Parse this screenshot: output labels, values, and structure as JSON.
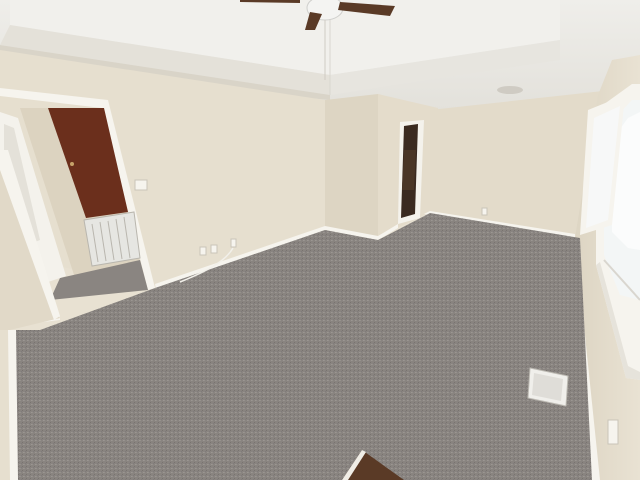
{
  "scene": {
    "description_free": true,
    "colors": {
      "wall_light": "#e8e1d2",
      "wall_mid": "#ddd5c4",
      "wall_shadow": "#cfc6b3",
      "ceiling": "#efeeea",
      "ceiling_shadow": "#e2e0da",
      "carpet": "#8f8a86",
      "carpet_dark": "#7f7a76",
      "trim": "#f6f4ee",
      "door_wood": "#6b2f1c",
      "dark_doorway": "#3a2a20",
      "floor_wood": "#5a3a26",
      "vent": "#e6e6e2",
      "window_glass": "#f3f6f6"
    },
    "icons": [
      "ceiling-fan-icon",
      "smoke-detector-icon",
      "floor-vent-icon",
      "outlet-icon",
      "light-switch-icon"
    ]
  }
}
